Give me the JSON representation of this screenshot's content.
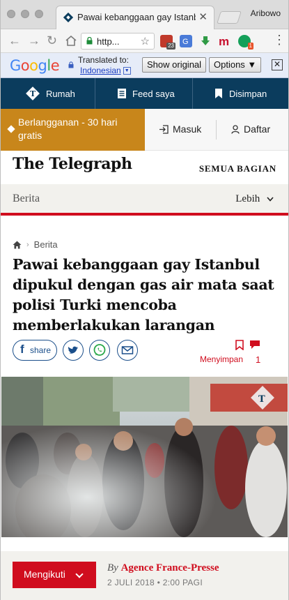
{
  "browser": {
    "tab_title": "Pawai kebanggaan gay Istanbul",
    "profile_name": "Aribowo",
    "url_text": "http...",
    "extensions": [
      {
        "icon": "calendar-extension-icon",
        "badge": "23",
        "color": "#c0392b"
      },
      {
        "icon": "google-translate-icon",
        "badge": "",
        "color": "#4a7bd8"
      },
      {
        "icon": "download-arrow-icon",
        "badge": "",
        "color": "#2f9a45"
      },
      {
        "icon": "mendeley-icon",
        "badge": "",
        "color": "#c8102e"
      },
      {
        "icon": "grammarly-icon",
        "badge": "1",
        "color": "#15a05a"
      }
    ]
  },
  "translate_bar": {
    "google_label": "Google",
    "translated_to_label": "Translated to:",
    "language": "Indonesian",
    "show_original": "Show original",
    "options": "Options ▼",
    "close": "✕"
  },
  "site_nav": {
    "home": "Rumah",
    "feed": "Feed saya",
    "saved": "Disimpan"
  },
  "account_bar": {
    "subscribe": "Berlangganan - 30 hari gratis",
    "login": "Masuk",
    "register": "Daftar"
  },
  "masthead": {
    "logo": "The Telegraph",
    "all_sections": "SEMUA BAGIAN"
  },
  "section_bar": {
    "section": "Berita",
    "more": "Lebih"
  },
  "article": {
    "breadcrumb": "Berita",
    "headline": "Pawai kebanggaan gay Istanbul dipukul dengan gas air mata saat polisi Turki mencoba memberlakukan larangan",
    "share_label": "share",
    "save_label": "Menyimpan",
    "comment_count": "1"
  },
  "follow_bar": {
    "follow_label": "Mengikuti",
    "by_label": "By",
    "author": "Agence France-Presse",
    "date": "2 JULI 2018 • 2:00 PAGI"
  },
  "colors": {
    "nav_bg": "#0b3c5d",
    "subscribe_bg": "#c8861b",
    "accent_red": "#d00d1e",
    "share_blue": "#1a4e8a",
    "whatsapp_green": "#2aa84a"
  }
}
